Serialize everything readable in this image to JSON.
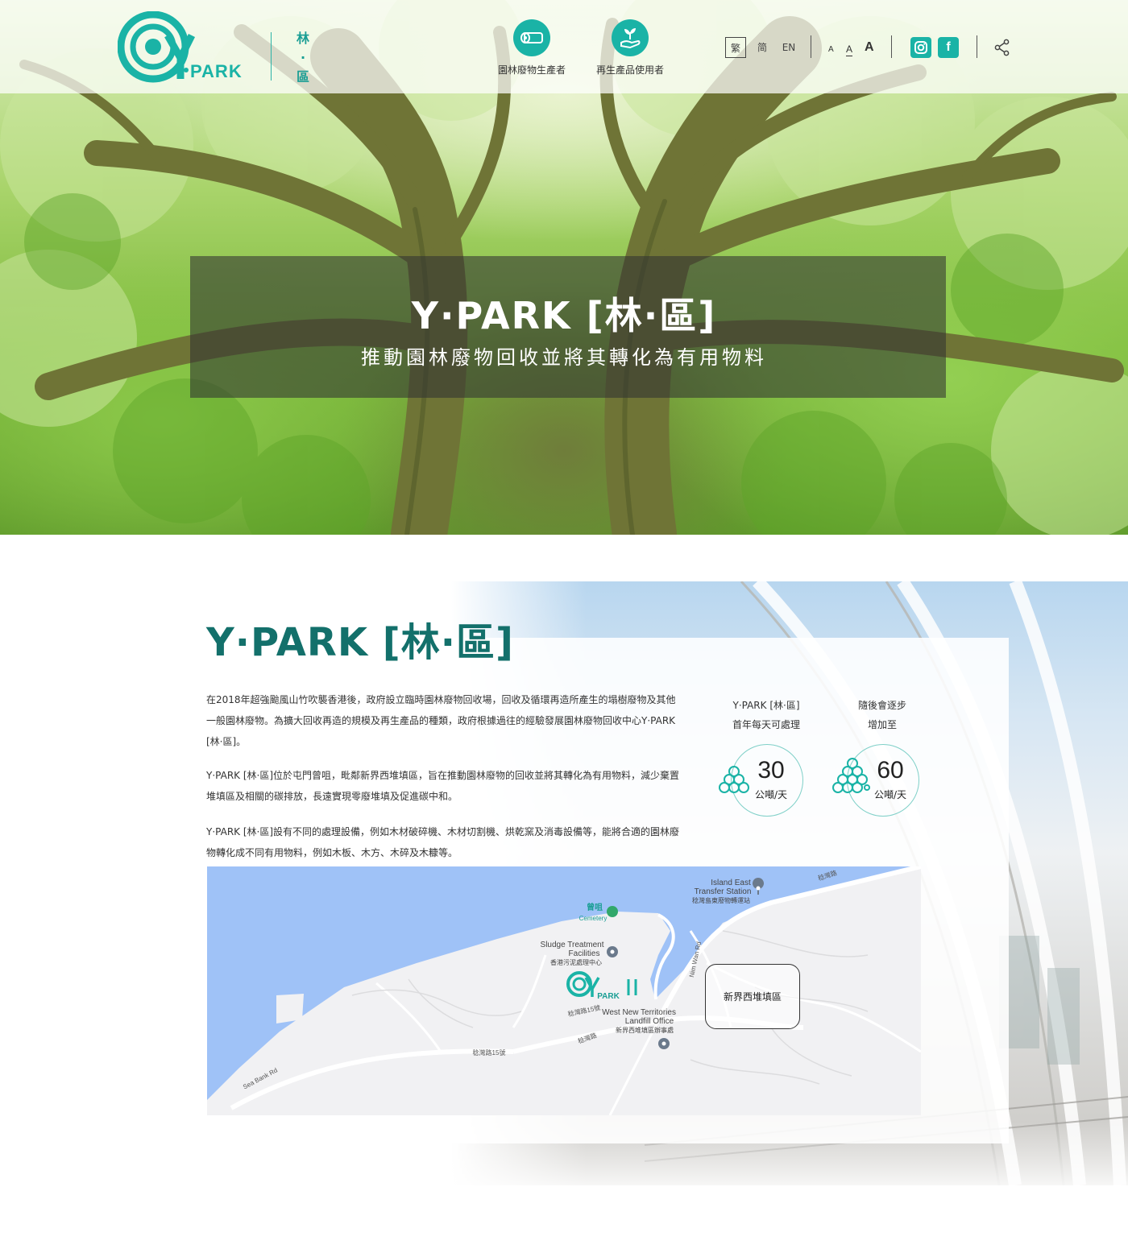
{
  "header": {
    "logo_text": "PARK",
    "logo_letter": "Y",
    "logo_sub": [
      "林",
      "·",
      "區"
    ],
    "nav": [
      {
        "label": "園林廢物生產者",
        "icon": "log-icon"
      },
      {
        "label": "再生產品使用者",
        "icon": "sprout-in-hand-icon"
      }
    ],
    "languages": [
      "繁",
      "简",
      "EN"
    ],
    "active_language": "繁",
    "font_sizes": [
      "A",
      "A",
      "A"
    ],
    "social": [
      {
        "name": "instagram-icon",
        "glyph": "◎"
      },
      {
        "name": "facebook-icon",
        "glyph": "f"
      }
    ],
    "share_icon": "share-icon"
  },
  "hero": {
    "title": "Y·PARK [林·區]",
    "subtitle": "推動園林廢物回收並將其轉化為有用物料"
  },
  "about": {
    "title": "Y·PARK [林·區]",
    "paragraphs": [
      "在2018年超強颱風山竹吹襲香港後，政府設立臨時園林廢物回收場，回收及循環再造所產生的塌樹廢物及其他一般園林廢物。為擴大回收再造的規模及再生產品的種類，政府根據過往的經驗發展園林廢物回收中心Y·PARK [林·區]。",
      "Y·PARK [林·區]位於屯門曾咀，毗鄰新界西堆填區，旨在推動園林廢物的回收並將其轉化為有用物料，減少棄置堆填區及相關的碳排放，長遠實現零廢堆填及促進碳中和。",
      "Y·PARK [林·區]設有不同的處理設備，例如木材破碎機、木材切割機、烘乾窯及消毒設備等，能將合適的園林廢物轉化成不同有用物料，例如木板、木方、木碎及木糠等。"
    ],
    "stats": [
      {
        "heading_line1": "Y·PARK [林·區]",
        "heading_line2": "首年每天可處理",
        "value": "30",
        "unit": "公噸/天"
      },
      {
        "heading_line1": "隨後會逐步",
        "heading_line2": "增加至",
        "value": "60",
        "unit": "公噸/天"
      }
    ]
  },
  "map": {
    "labels": {
      "transfer_en1": "Island East",
      "transfer_en2": "Transfer Station",
      "transfer_zh": "稔灣島東廢物轉運站",
      "road_top": "稔灣路",
      "cemetery_zh": "曾咀",
      "cemetery_en": "Cemetery",
      "sludge_en1": "Sludge Treatment",
      "sludge_en2": "Facilities",
      "sludge_zh": "香港污泥處理中心",
      "nimwan_rd": "Nim Wan Rd",
      "landfill_en1": "West New Territories",
      "landfill_en2": "Landfill Office",
      "landfill_zh": "新界西堆填區辦事處",
      "road_15_a": "稔灣路15號",
      "road_mid": "稔灣路",
      "road_15_b": "稔灣路15號",
      "seabank": "Sea Bank Rd",
      "landfill_box": "新界西堆填區",
      "marker_park": "PARK"
    },
    "colors": {
      "water": "#9fc2f7",
      "land": "#f1f1f3",
      "road": "#ffffff",
      "pin": "#6b7a8c",
      "teal": "#1ab3a6"
    }
  },
  "colors": {
    "brand_teal": "#1ab3a6",
    "title_teal": "#13706b"
  }
}
